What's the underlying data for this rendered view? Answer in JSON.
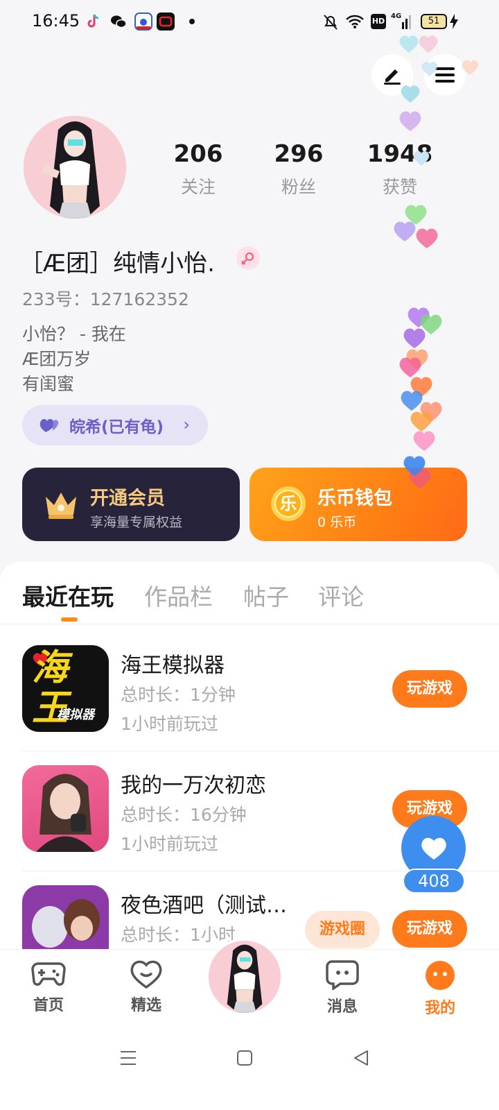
{
  "status_bar": {
    "time": "16:45",
    "network": "4G",
    "battery": "51"
  },
  "profile": {
    "stats": [
      {
        "value": "206",
        "label": "关注"
      },
      {
        "value": "296",
        "label": "粉丝"
      },
      {
        "value": "1948",
        "label": "获赞"
      }
    ],
    "nickname": "［Æ团］纯情小怡.",
    "uid": "233号：127162352",
    "bio": [
      "小怡？ - 我在",
      "Æ团万岁",
      "有闺蜜"
    ],
    "cp_chip": "皖希(已有龟)"
  },
  "cards": {
    "vip": {
      "title": "开通会员",
      "subtitle": "享海量专属权益"
    },
    "wallet": {
      "title": "乐币钱包",
      "subtitle": "0 乐币",
      "coin_char": "乐"
    }
  },
  "tabs": [
    {
      "label": "最近在玩",
      "active": true
    },
    {
      "label": "作品栏",
      "active": false
    },
    {
      "label": "帖子",
      "active": false
    },
    {
      "label": "评论",
      "active": false
    }
  ],
  "games": [
    {
      "title": "海王模拟器",
      "duration": "总时长：1分钟",
      "last_played": "1小时前玩过",
      "button": "玩游戏",
      "icon_text_big": "海王",
      "icon_text_small": "模拟器"
    },
    {
      "title": "我的一万次初恋",
      "duration": "总时长：16分钟",
      "last_played": "1小时前玩过",
      "button": "玩游戏"
    },
    {
      "title": "夜色酒吧（测试…",
      "duration": "总时长：1小时",
      "button": "玩游戏"
    }
  ],
  "game_circle_button": "游戏圈",
  "like_float": {
    "count": "408"
  },
  "bottom_nav": [
    {
      "label": "首页",
      "icon": "gamepad-icon"
    },
    {
      "label": "精选",
      "icon": "heart-chat-icon"
    },
    {
      "label": "消息",
      "icon": "message-icon"
    },
    {
      "label": "我的",
      "icon": "profile-face-icon",
      "active": true
    }
  ],
  "colors": {
    "accent": "#ff7a1a",
    "vip_gold": "#f6c980",
    "like_blue": "#3e8ef0",
    "chip_purple": "#6b5fc9"
  }
}
